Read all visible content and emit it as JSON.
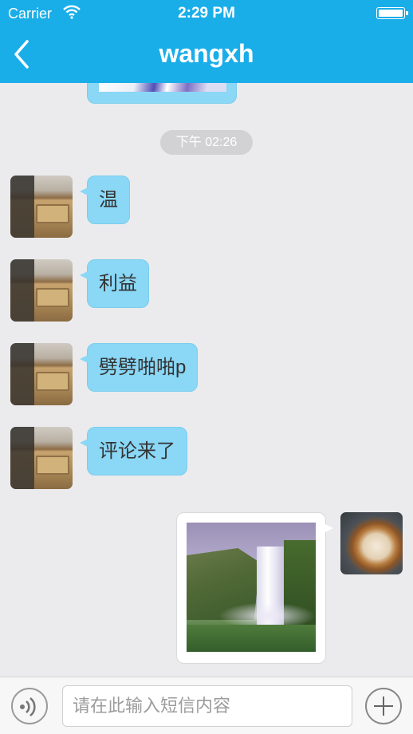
{
  "status_bar": {
    "carrier": "Carrier",
    "time": "2:29 PM"
  },
  "header": {
    "title": "wangxh",
    "back_icon": "chevron-left-icon"
  },
  "chat": {
    "timestamp": "下午 02:26",
    "messages": [
      {
        "side": "left",
        "type": "text",
        "text": "温"
      },
      {
        "side": "left",
        "type": "text",
        "text": "利益"
      },
      {
        "side": "left",
        "type": "text",
        "text": "劈劈啪啪p"
      },
      {
        "side": "left",
        "type": "text",
        "text": "评论来了"
      },
      {
        "side": "right",
        "type": "image",
        "image": "waterfall-photo"
      }
    ]
  },
  "input_bar": {
    "placeholder": "请在此输入短信内容",
    "voice_icon": "voice-icon",
    "add_icon": "plus-icon"
  },
  "colors": {
    "header": "#1aaee9",
    "bubble": "#8ad7f6",
    "background": "#ebebed"
  }
}
